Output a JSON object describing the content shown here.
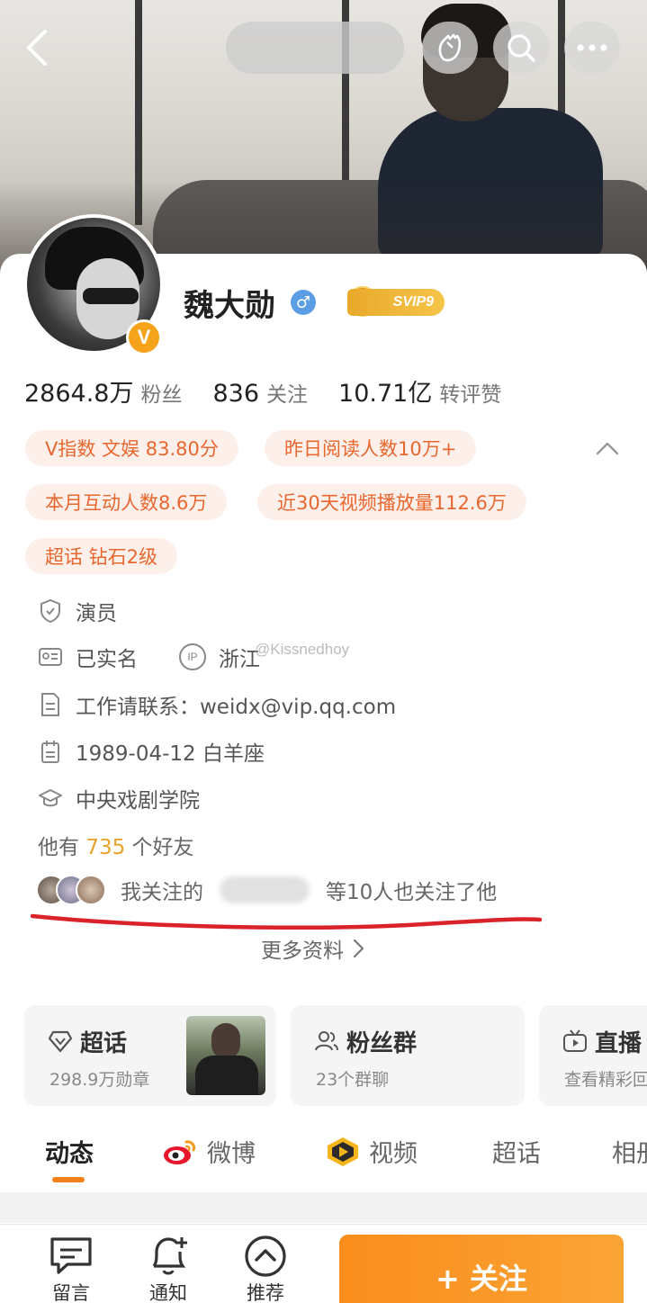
{
  "header": {
    "back_icon": "chevron-left-icon",
    "actions": [
      "clap-hand-icon",
      "search-icon",
      "more-icon"
    ]
  },
  "profile": {
    "name": "魏大勋",
    "verified_badge": "V",
    "svip": "SVIP9",
    "stats": [
      {
        "num": "2864.8万",
        "label": "粉丝"
      },
      {
        "num": "836",
        "label": "关注"
      },
      {
        "num": "10.71亿",
        "label": "转评赞"
      }
    ],
    "tags": [
      "V指数 文娱 83.80分",
      "昨日阅读人数10万+",
      "本月互动人数8.6万",
      "近30天视频播放量112.6万",
      "超话 钻石2级"
    ],
    "info": {
      "occupation": "演员",
      "real_name": "已实名",
      "ip_label": "IP",
      "ip_location": "浙江",
      "contact": "工作请联系：weidx@vip.qq.com",
      "birthday": "1989-04-12 白羊座",
      "school": "中央戏剧学院"
    },
    "watermark": "@Kissnedhoy",
    "friends": {
      "prefix": "他有 ",
      "count": "735",
      "suffix": " 个好友"
    },
    "mutual": {
      "prefix": "我关注的",
      "suffix": "等10人也关注了他"
    },
    "more_info": "更多资料"
  },
  "features": [
    {
      "title": "超话",
      "sub": "298.9万勋章",
      "icon": "diamond-icon"
    },
    {
      "title": "粉丝群",
      "sub": "23个群聊",
      "icon": "group-icon"
    },
    {
      "title": "直播",
      "sub": "查看精彩回",
      "icon": "live-icon"
    }
  ],
  "tabs": [
    "动态",
    "微博",
    "视频",
    "超话",
    "相册"
  ],
  "bottom": {
    "message": "留言",
    "notify": "通知",
    "recommend": "推荐",
    "follow": "+ 关注"
  },
  "colors": {
    "accent": "#f07f1c",
    "tag_bg": "#fdf0ea",
    "tag_text": "#e8672f",
    "highlight": "#e8a42a",
    "annotation": "#d9222a"
  }
}
